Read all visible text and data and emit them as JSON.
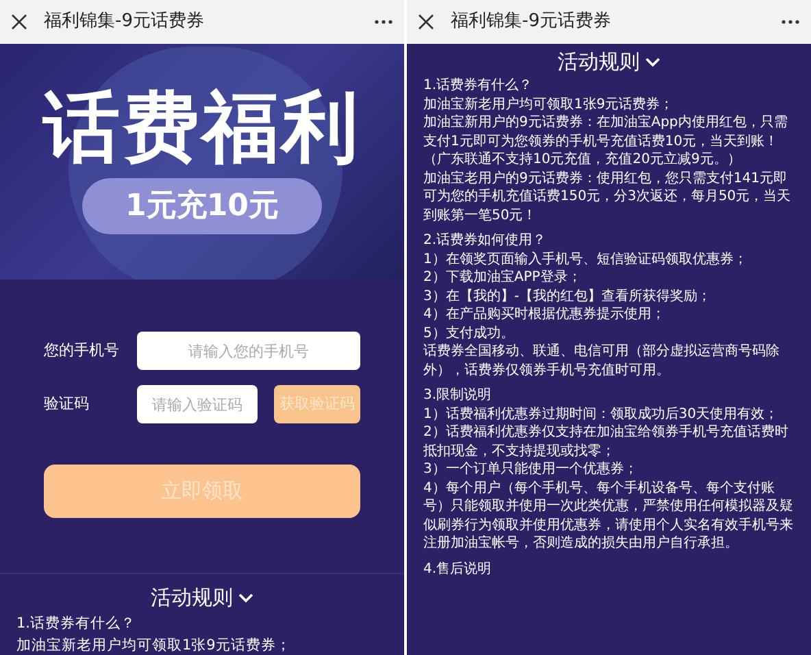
{
  "screens": [
    {
      "kind": "form",
      "title": "福利锦集-9元话费券",
      "banner": {
        "headline": "话费福利",
        "tagline": "1元充10元"
      },
      "form": {
        "fields": [
          {
            "label": "您的手机号",
            "placeholder": "请输入您的手机号"
          },
          {
            "label": "验证码",
            "placeholder": "请输入验证码",
            "button": "获取验证码"
          }
        ],
        "submit": "立即领取"
      },
      "rules": {
        "heading": "活动规则",
        "sections": [
          [
            "1.话费券有什么？",
            "加油宝新老用户均可领取1张9元话费券；"
          ]
        ]
      }
    },
    {
      "kind": "rules",
      "title": "福利锦集-9元话费券",
      "rules": {
        "heading": "活动规则",
        "sections": [
          [
            "1.话费券有什么？",
            "加油宝新老用户均可领取1张9元话费券；",
            "加油宝新用户的9元话费券：在加油宝App内使用红包，只需支付1元即可为您领券的手机号充值话费10元，当天到账！（广东联通不支持10元充值，充值20元立减9元。）",
            "加油宝老用户的9元话费券：使用红包，您只需支付141元即可为您的手机充值话费150元，分3次返还，每月50元，当天到账第一笔50元！"
          ],
          [
            "2.话费券如何使用？",
            "1）在领奖页面输入手机号、短信验证码领取优惠券；",
            "2）下载加油宝APP登录；",
            "3）在【我的】-【我的红包】查看所获得奖励；",
            "4）在产品购买时根据优惠券提示使用；",
            "5）支付成功。",
            "话费券全国移动、联通、电信可用（部分虚拟运营商号码除外），话费券仅领券手机号充值时可用。"
          ],
          [
            "3.限制说明",
            "1）话费福利优惠券过期时间：领取成功后30天使用有效；",
            "2）话费福利优惠券仅支持在加油宝给领券手机号充值话费时抵扣现金，不支持提现或找零；",
            "3）一个订单只能使用一个优惠券；",
            "4）每个用户（每个手机号、每个手机设备号、每个支付账号）只能领取并使用一次此类优惠，严禁使用任何模拟器及疑似刷券行为领取并使用优惠券，请使用个人实名有效手机号来注册加油宝帐号，否则造成的损失由用户自行承担。"
          ],
          [
            "4.售后说明"
          ]
        ]
      }
    }
  ]
}
